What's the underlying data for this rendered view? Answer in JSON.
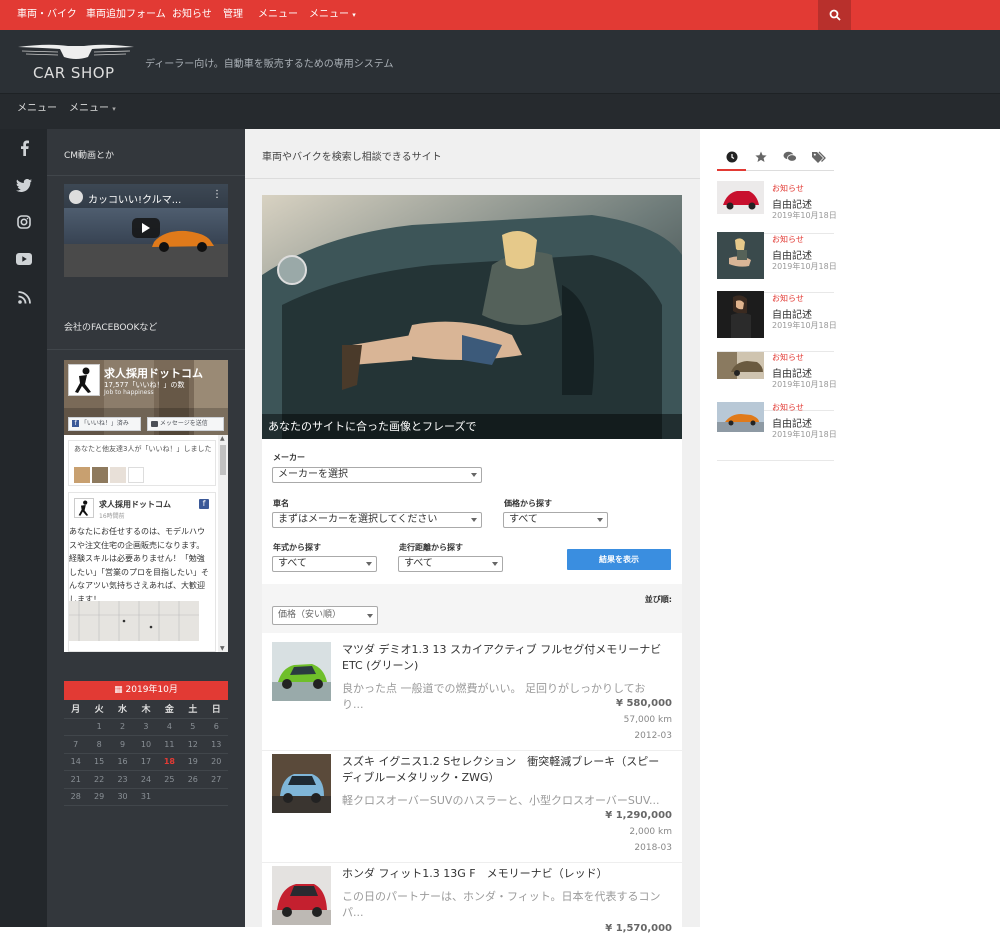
{
  "colors": {
    "accent": "#e23a34",
    "dark_header": "#2b3035",
    "sidebar": "#33373c",
    "button": "#3a8ee0"
  },
  "topnav": {
    "items": [
      "車両・バイク",
      "車両追加フォーム",
      "お知らせ",
      "管理",
      "メニュー",
      "メニュー"
    ],
    "search_icon": "search-icon"
  },
  "header": {
    "logo_text": "CAR SHOP",
    "tagline": "ディーラー向け。自動車を販売するための専用システム"
  },
  "subnav": {
    "items": [
      "メニュー",
      "メニュー"
    ]
  },
  "social_icons": [
    "facebook-icon",
    "twitter-icon",
    "instagram-icon",
    "youtube-icon",
    "rss-icon"
  ],
  "left_sidebar": {
    "video_widget": {
      "title": "CM動画とか",
      "video_title": "カッコいい!クルマ..."
    },
    "facebook_widget": {
      "title": "会社のFACEBOOKなど",
      "page_name": "求人採用ドットコム",
      "likes": "17,577「いいね！」の数",
      "motto": "Job to happiness",
      "like_button": "「いいね！」済み",
      "message_button": "メッセージを送信",
      "friends_text": "あなたと他友達3人が「いいね！」しました",
      "post_author": "求人採用ドットコム",
      "post_time": "16時間前",
      "post_text": "あなたにお任せするのは、モデルハウスや注文住宅の企画販売になります。経験スキルは必要ありません！「勉強したい」「営業のプロを目指したい」そんなアツい気持ちさえあれば、大歓迎します！"
    },
    "calendar": {
      "title": "2019年10月",
      "weekdays": [
        "月",
        "火",
        "水",
        "木",
        "金",
        "土",
        "日"
      ],
      "weeks": [
        [
          "",
          "1",
          "2",
          "3",
          "4",
          "5",
          "6"
        ],
        [
          "7",
          "8",
          "9",
          "10",
          "11",
          "12",
          "13"
        ],
        [
          "14",
          "15",
          "16",
          "17",
          "18",
          "19",
          "20"
        ],
        [
          "21",
          "22",
          "23",
          "24",
          "25",
          "26",
          "27"
        ],
        [
          "28",
          "29",
          "30",
          "31",
          "",
          "",
          ""
        ]
      ],
      "today": "18"
    }
  },
  "main": {
    "title": "車両やバイクを検索し相談できるサイト",
    "hero_caption": "あなたのサイトに合った画像とフレーズで",
    "search": {
      "maker_label": "メーカー",
      "maker_value": "メーカーを選択",
      "model_label": "車名",
      "model_value": "まずはメーカーを選択してください",
      "price_label": "価格から探す",
      "price_value": "すべて",
      "year_label": "年式から探す",
      "year_value": "すべて",
      "mileage_label": "走行距離から探す",
      "mileage_value": "すべて",
      "submit_label": "結果を表示"
    },
    "sort": {
      "label": "並び順:",
      "value": "価格（安い順）"
    },
    "listings": [
      {
        "title": "マツダ デミオ1.3 13 スカイアクティブ フルセグ付メモリーナビ ETC (グリーン)",
        "desc": "良かった点 一般道での燃費がいい。 足回りがしっかりしており...",
        "price": "¥ 580,000",
        "mileage": "57,000 km",
        "date": "2012-03",
        "color": "#6fbf2a"
      },
      {
        "title": "スズキ イグニス1.2 Sセレクション　衝突軽減ブレーキ（スピーディブルーメタリック・ZWG）",
        "desc": "軽クロスオーバーSUVのハスラーと、小型クロスオーバーSUV...",
        "price": "¥ 1,290,000",
        "mileage": "2,000 km",
        "date": "2018-03",
        "color": "#7fb6d8"
      },
      {
        "title": "ホンダ フィット1.3 13G F　メモリーナビ（レッド）",
        "desc": "この日のパートナーは、ホンダ・フィット。日本を代表するコンパ...",
        "price": "¥ 1,570,000",
        "mileage": "",
        "date": "",
        "color": "#c4202f"
      }
    ]
  },
  "right_sidebar": {
    "tabs": [
      "clock-icon",
      "star-icon",
      "comments-icon",
      "tags-icon"
    ],
    "posts": [
      {
        "category": "お知らせ",
        "title": "自由記述",
        "date": "2019年10月18日"
      },
      {
        "category": "お知らせ",
        "title": "自由記述",
        "date": "2019年10月18日"
      },
      {
        "category": "お知らせ",
        "title": "自由記述",
        "date": "2019年10月18日"
      },
      {
        "category": "お知らせ",
        "title": "自由記述",
        "date": "2019年10月18日"
      },
      {
        "category": "お知らせ",
        "title": "自由記述",
        "date": "2019年10月18日"
      }
    ]
  }
}
